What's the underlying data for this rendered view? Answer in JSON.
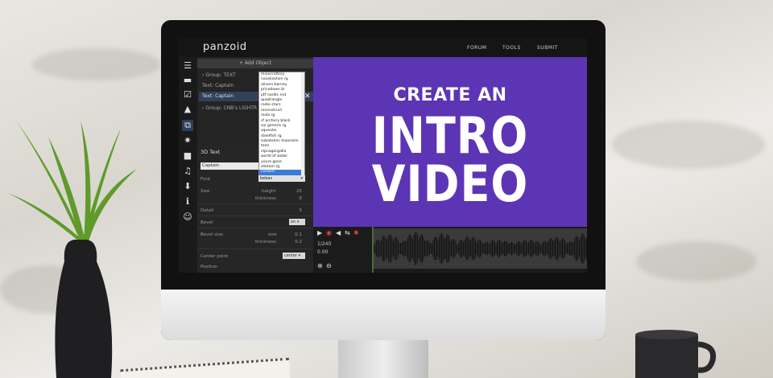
{
  "app": {
    "logo": "panzoid",
    "nav": [
      "FORUM",
      "TOOLS",
      "SUBMIT"
    ]
  },
  "rail_icons": [
    "menu-icon",
    "folder-icon",
    "checkbox-icon",
    "image-icon",
    "cube-icon",
    "sparkle-icon",
    "camera-icon",
    "music-icon",
    "download-icon",
    "info-icon",
    "smiley-icon"
  ],
  "objects": {
    "add_label": "+ Add Object",
    "tree": [
      "Group: TEXT",
      "Text: Captain",
      "Text: Captain",
      "Group: CNB's LIGHTR"
    ]
  },
  "fonts": {
    "items": [
      "minecraftory",
      "nasalization rg",
      "olivers barney",
      "pricedown bl",
      "ptf nordic rnd",
      "quadrangle",
      "radio stars",
      "reconstruct",
      "resla rg",
      "sf archery black",
      "sui generis rg",
      "squealer",
      "steelfish rg",
      "subatomic tsoonami",
      "teen",
      "vlpnagorgalla",
      "world of water",
      "youre gone",
      "zektom rg",
      "custom"
    ],
    "highlighted": "custom",
    "selected": "bebas"
  },
  "props": {
    "heading": "3D Text",
    "text_value": "Captain",
    "font_label": "Font",
    "size_label": "Size",
    "height_label": "height",
    "height_value": "25",
    "thickness_label": "thickness",
    "thickness_value": "6",
    "detail_label": "Detail",
    "detail_value": "5",
    "bevel_label": "Bevel",
    "bevel_value": "on",
    "bevel_size_label": "Bevel size",
    "bsize_label": "size",
    "bsize_value": "0.1",
    "bthick_label": "thickness",
    "bthick_value": "0.2",
    "center_label": "Center point",
    "center_value": "center",
    "position_label": "Position"
  },
  "preview": {
    "line1": "CREATE AN",
    "line2": "INTRO",
    "line3": "VIDEO",
    "bg_color": "#5c35b4"
  },
  "timeline": {
    "frame": "1/240",
    "time": "0.00"
  }
}
